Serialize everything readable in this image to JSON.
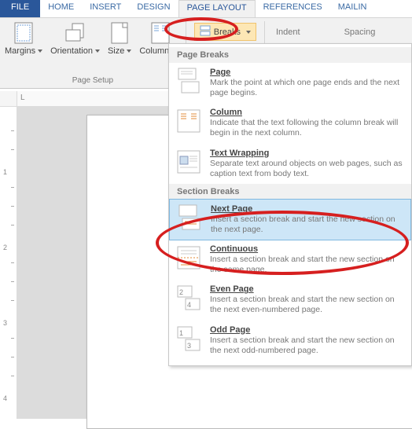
{
  "tabs": {
    "file": "FILE",
    "home": "HOME",
    "insert": "INSERT",
    "design": "DESIGN",
    "page_layout": "PAGE LAYOUT",
    "references": "REFERENCES",
    "mailings": "MAILIN"
  },
  "ribbon": {
    "margins": "Margins",
    "orientation": "Orientation",
    "size": "Size",
    "columns": "Columns",
    "page_setup_label": "Page Setup",
    "breaks_label": "Breaks",
    "indent_label": "Indent",
    "spacing_label": "Spacing"
  },
  "breaks_menu": {
    "page_breaks_heading": "Page Breaks",
    "section_breaks_heading": "Section Breaks",
    "items": {
      "page": {
        "title": "Page",
        "desc": "Mark the point at which one page ends and the next page begins."
      },
      "column": {
        "title": "Column",
        "desc": "Indicate that the text following the column break will begin in the next column."
      },
      "text_wrapping": {
        "title": "Text Wrapping",
        "desc": "Separate text around objects on web pages, such as caption text from body text."
      },
      "next_page": {
        "title": "Next Page",
        "desc": "Insert a section break and start the new section on the next page."
      },
      "continuous": {
        "title": "Continuous",
        "desc": "Insert a section break and start the new section on the same page."
      },
      "even_page": {
        "title": "Even Page",
        "desc": "Insert a section break and start the new section on the next even-numbered page."
      },
      "odd_page": {
        "title": "Odd Page",
        "desc": "Insert a section break and start the new section on the next odd-numbered page."
      }
    }
  },
  "ruler": {
    "top_mark": "L",
    "marks": [
      "1",
      "2",
      "3",
      "4"
    ]
  }
}
